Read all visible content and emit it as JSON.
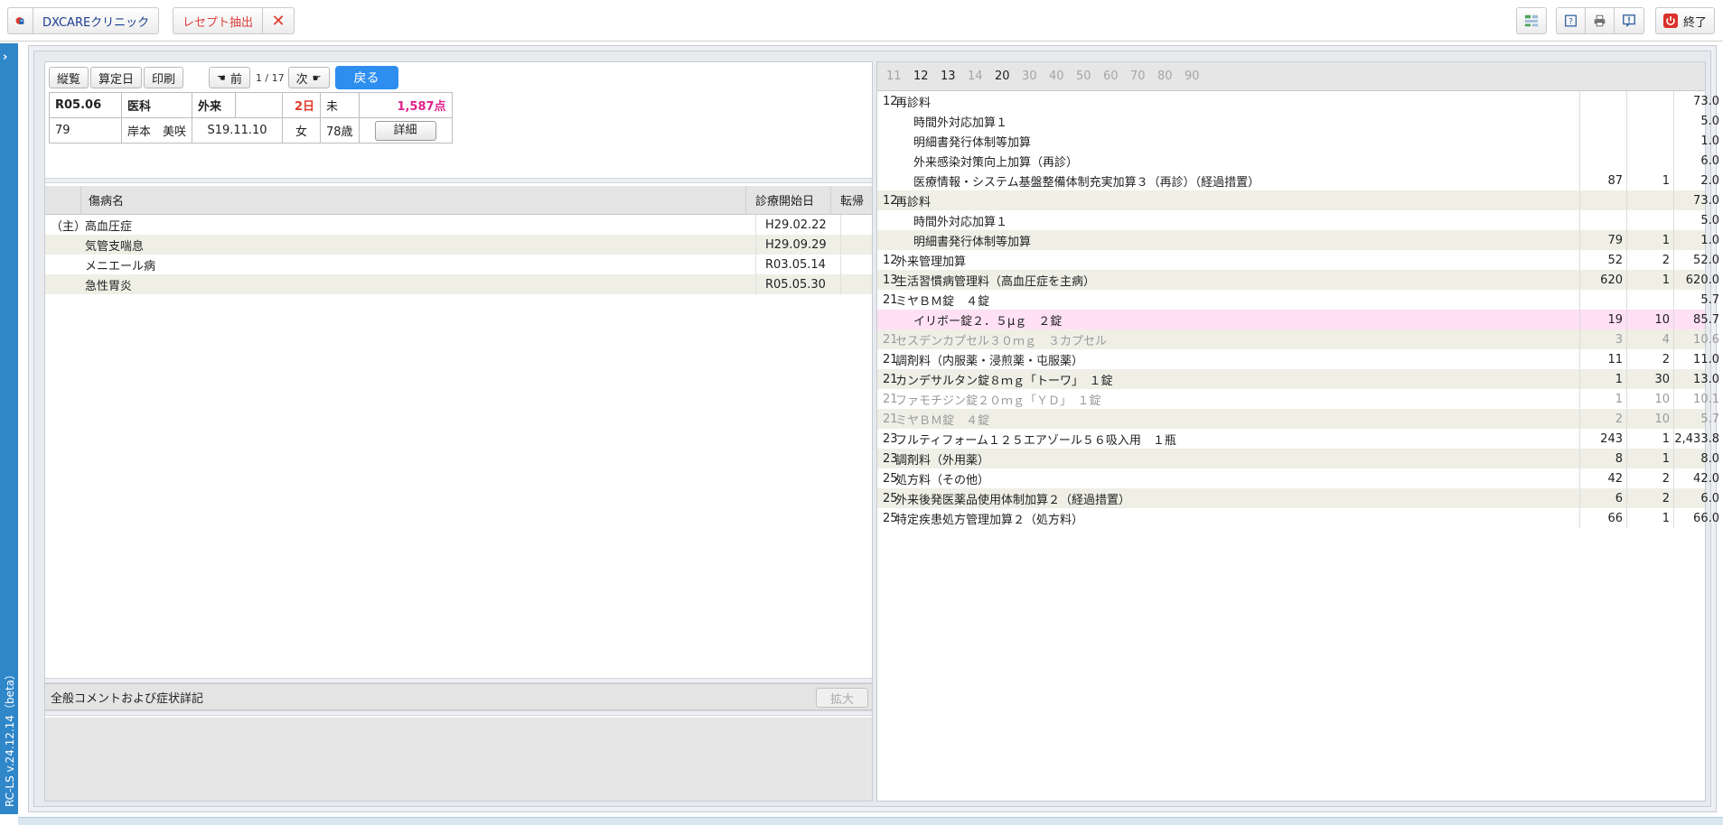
{
  "topbar": {
    "clinic_name": "DXCAREクリニック",
    "receipt_extract_label": "レセプト抽出",
    "exit_label": "終了"
  },
  "sidebar": {
    "version": "RC-LS v.24.12.14（beta）"
  },
  "controls": {
    "overview_label": "縦覧",
    "calc_date_label": "算定日",
    "print_label": "印刷",
    "prev_label": "前",
    "pager": "1 / 17",
    "next_label": "次",
    "back_label": "戻る"
  },
  "receipt": {
    "period": "R05.06",
    "dept": "医科",
    "type": "外来",
    "blank": "",
    "days": "2日",
    "status": "未",
    "points": "1,587点",
    "patient_no": "79",
    "patient_name": "岸本　美咲",
    "birth": "S19.11.10",
    "sex": "女",
    "age": "78歳",
    "detail_label": "詳細"
  },
  "diseases": {
    "headers": {
      "name": "傷病名",
      "start": "診療開始日",
      "outcome": "転帰"
    },
    "rows": [
      {
        "mark": "（主）",
        "name": "高血圧症",
        "start": "H29.02.22",
        "outcome": ""
      },
      {
        "mark": "",
        "name": "気管支喘息",
        "start": "H29.09.29",
        "outcome": ""
      },
      {
        "mark": "",
        "name": "メニエール病",
        "start": "R03.05.14",
        "outcome": ""
      },
      {
        "mark": "",
        "name": "急性胃炎",
        "start": "R05.05.30",
        "outcome": ""
      }
    ]
  },
  "comment": {
    "title": "全般コメントおよび症状詳記",
    "expand_label": "拡大"
  },
  "tabs": [
    {
      "label": "11",
      "active": false
    },
    {
      "label": "12",
      "active": true
    },
    {
      "label": "13",
      "active": true
    },
    {
      "label": "14",
      "active": false
    },
    {
      "label": "20",
      "active": true
    },
    {
      "label": "30",
      "active": false
    },
    {
      "label": "40",
      "active": false
    },
    {
      "label": "50",
      "active": false
    },
    {
      "label": "60",
      "active": false
    },
    {
      "label": "70",
      "active": false
    },
    {
      "label": "80",
      "active": false
    },
    {
      "label": "90",
      "active": false
    }
  ],
  "items": [
    {
      "code": "12",
      "name": "再診料",
      "indent": false,
      "pts": "",
      "qty": "",
      "total": "73.0",
      "style": ""
    },
    {
      "code": "",
      "name": "時間外対応加算１",
      "indent": true,
      "pts": "",
      "qty": "",
      "total": "5.0",
      "style": ""
    },
    {
      "code": "",
      "name": "明細書発行体制等加算",
      "indent": true,
      "pts": "",
      "qty": "",
      "total": "1.0",
      "style": ""
    },
    {
      "code": "",
      "name": "外来感染対策向上加算（再診）",
      "indent": true,
      "pts": "",
      "qty": "",
      "total": "6.0",
      "style": ""
    },
    {
      "code": "",
      "name": "医療情報・システム基盤整備体制充実加算３（再診）（経過措置）",
      "indent": true,
      "pts": "87",
      "qty": "1",
      "total": "2.0",
      "style": ""
    },
    {
      "code": "12",
      "name": "再診料",
      "indent": false,
      "pts": "",
      "qty": "",
      "total": "73.0",
      "style": "alt"
    },
    {
      "code": "",
      "name": "時間外対応加算１",
      "indent": true,
      "pts": "",
      "qty": "",
      "total": "5.0",
      "style": ""
    },
    {
      "code": "",
      "name": "明細書発行体制等加算",
      "indent": true,
      "pts": "79",
      "qty": "1",
      "total": "1.0",
      "style": "alt"
    },
    {
      "code": "12",
      "name": "外来管理加算",
      "indent": false,
      "pts": "52",
      "qty": "2",
      "total": "52.0",
      "style": ""
    },
    {
      "code": "13",
      "name": "生活習慣病管理料（高血圧症を主病）",
      "indent": false,
      "pts": "620",
      "qty": "1",
      "total": "620.0",
      "style": "alt"
    },
    {
      "code": "21",
      "name": "ミヤＢＭ錠　４錠",
      "indent": false,
      "pts": "",
      "qty": "",
      "total": "5.7",
      "style": ""
    },
    {
      "code": "",
      "name": "イリボー錠２．５μｇ　２錠",
      "indent": true,
      "pts": "19",
      "qty": "10",
      "total": "85.7",
      "style": "hl"
    },
    {
      "code": "21",
      "name": "セスデンカプセル３０ｍｇ　３カプセル",
      "indent": false,
      "pts": "3",
      "qty": "4",
      "total": "10.6",
      "style": "alt muted"
    },
    {
      "code": "21",
      "name": "調剤料（内服薬・浸煎薬・屯服薬）",
      "indent": false,
      "pts": "11",
      "qty": "2",
      "total": "11.0",
      "style": ""
    },
    {
      "code": "21",
      "name": "カンデサルタン錠８ｍｇ「トーワ」　１錠",
      "indent": false,
      "pts": "1",
      "qty": "30",
      "total": "13.0",
      "style": "alt"
    },
    {
      "code": "21",
      "name": "ファモチジン錠２０ｍｇ「ＹＤ」　１錠",
      "indent": false,
      "pts": "1",
      "qty": "10",
      "total": "10.1",
      "style": "muted"
    },
    {
      "code": "21",
      "name": "ミヤＢＭ錠　４錠",
      "indent": false,
      "pts": "2",
      "qty": "10",
      "total": "5.7",
      "style": "alt muted"
    },
    {
      "code": "23",
      "name": "フルティフォーム１２５エアゾール５６吸入用　１瓶",
      "indent": false,
      "pts": "243",
      "qty": "1",
      "total": "2,433.8",
      "style": ""
    },
    {
      "code": "23",
      "name": "調剤料（外用薬）",
      "indent": false,
      "pts": "8",
      "qty": "1",
      "total": "8.0",
      "style": "alt"
    },
    {
      "code": "25",
      "name": "処方料（その他）",
      "indent": false,
      "pts": "42",
      "qty": "2",
      "total": "42.0",
      "style": ""
    },
    {
      "code": "25",
      "name": "外来後発医薬品使用体制加算２（経過措置）",
      "indent": false,
      "pts": "6",
      "qty": "2",
      "total": "6.0",
      "style": "alt"
    },
    {
      "code": "25",
      "name": "特定疾患処方管理加算２（処方料）",
      "indent": false,
      "pts": "66",
      "qty": "1",
      "total": "66.0",
      "style": ""
    }
  ]
}
